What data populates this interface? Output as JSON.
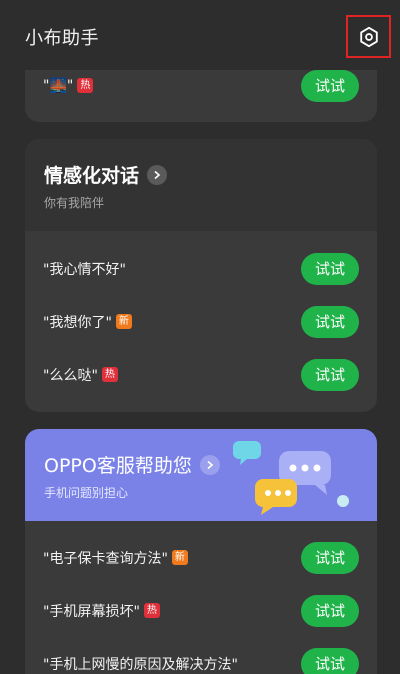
{
  "header": {
    "title": "小布助手"
  },
  "top_card": {
    "row": {
      "text": "\"🌉\"",
      "badge": "热",
      "button": "试试"
    }
  },
  "emotion_card": {
    "title": "情感化对话",
    "subtitle": "你有我陪伴",
    "rows": [
      {
        "text": "\"我心情不好\"",
        "badge": "",
        "button": "试试"
      },
      {
        "text": "\"我想你了\"",
        "badge": "新",
        "button": "试试"
      },
      {
        "text": "\"么么哒\"",
        "badge": "热",
        "button": "试试"
      }
    ]
  },
  "service_card": {
    "title": "OPPO客服帮助您",
    "subtitle": "手机问题别担心",
    "rows": [
      {
        "text": "\"电子保卡查询方法\"",
        "badge": "新",
        "button": "试试"
      },
      {
        "text": "\"手机屏幕损坏\"",
        "badge": "热",
        "button": "试试"
      },
      {
        "text": "\"手机上网慢的原因及解决方法\"",
        "badge": "",
        "button": "试试"
      }
    ]
  },
  "colors": {
    "accent_green": "#1fb34a",
    "hot_badge": "#e0303a",
    "new_badge": "#f07a1e",
    "service_blue": "#7a82e8"
  },
  "icons": {
    "settings": "gear-icon",
    "chevron": "chevron-right-icon",
    "chat": "chat-bubbles-icon"
  }
}
